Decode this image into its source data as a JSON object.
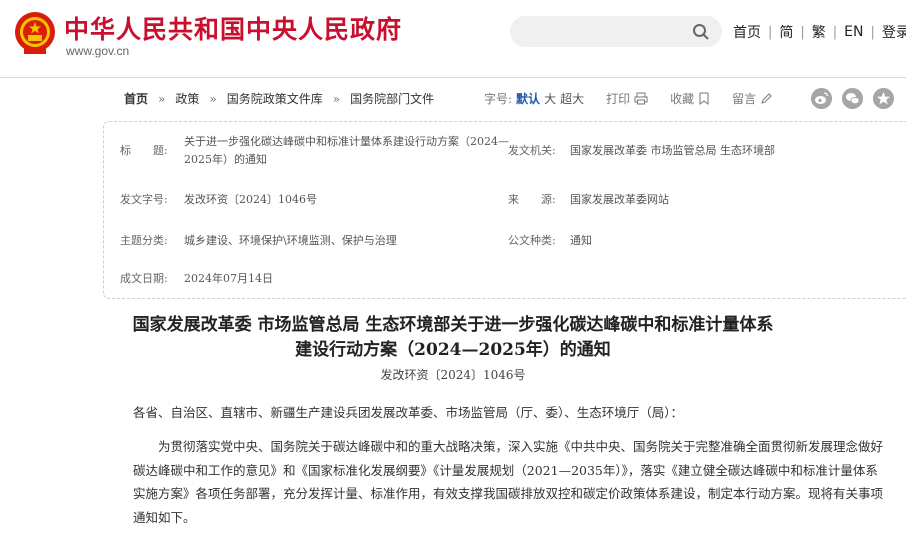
{
  "header": {
    "site_title": "中华人民共和国中央人民政府",
    "site_url": "www.gov.cn",
    "search_placeholder": "",
    "links": [
      "首页",
      "简",
      "繁",
      "EN",
      "登录"
    ],
    "separator": "|",
    "brand_color": "#c8102e"
  },
  "breadcrumb": {
    "items": [
      "首页",
      "政策",
      "国务院政策文件库",
      "国务院部门文件"
    ],
    "arrow": "»"
  },
  "tools": {
    "font_size_label": "字号:",
    "font_sizes": [
      "默认",
      "大",
      "超大"
    ],
    "active_font_size": "默认",
    "print": "打印",
    "favorite": "收藏",
    "comment": "留言",
    "share_icons": [
      "weibo-icon",
      "wechat-icon",
      "favorite-star-icon"
    ]
  },
  "info": {
    "title_label": "标　　题:",
    "title_value": "关于进一步强化碳达峰碳中和标准计量体系建设行动方案（2024—2025年）的通知",
    "issuer_label": "发文机关:",
    "issuer_value": "国家发展改革委  市场监管总局  生态环境部",
    "doc_no_label": "发文字号:",
    "doc_no_value": "发改环资〔2024〕1046号",
    "source_label": "来　　源:",
    "source_value": "国家发展改革委网站",
    "topic_label": "主题分类:",
    "topic_value": "城乡建设、环境保护\\环境监测、保护与治理",
    "type_label": "公文种类:",
    "type_value": "通知",
    "date_label": "成文日期:",
    "date_value": "2024年07月14日"
  },
  "document": {
    "title_line1": "国家发展改革委  市场监管总局  生态环境部关于进一步强化碳达峰碳中和标准计量体系",
    "title_line2": "建设行动方案（2024—2025年）的通知",
    "doc_number": "发改环资〔2024〕1046号",
    "addressee": "各省、自治区、直辖市、新疆生产建设兵团发展改革委、市场监管局（厅、委）、生态环境厅（局）：",
    "paragraph1": "为贯彻落实党中央、国务院关于碳达峰碳中和的重大战略决策，深入实施《中共中央、国务院关于完整准确全面贯彻新发展理念做好碳达峰碳中和工作的意见》和《国家标准化发展纲要》《计量发展规划（2021—2035年）》，落实《建立健全碳达峰碳中和标准计量体系实施方案》各项任务部署，充分发挥计量、标准作用，有效支撑我国碳排放双控和碳定价政策体系建设，制定本行动方案。现将有关事项通知如下。"
  }
}
